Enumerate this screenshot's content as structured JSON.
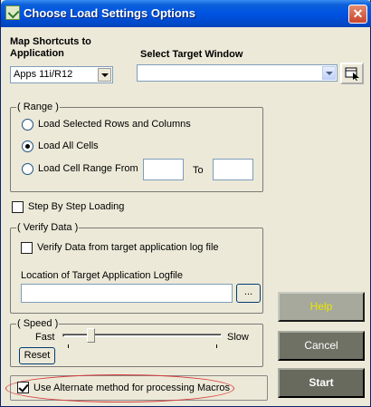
{
  "window": {
    "title": "Choose Load Settings Options",
    "close_glyph": "✕"
  },
  "mapping": {
    "label": "Map Shortcuts to Application",
    "application_value": "Apps 11i/R12"
  },
  "target": {
    "label": "Select Target Window",
    "value": ""
  },
  "range": {
    "legend": "( Range )",
    "opt_selected": "Load Selected Rows and Columns",
    "opt_all": "Load All Cells",
    "opt_cell_range": "Load Cell Range From",
    "to_label": "To",
    "from_value": "",
    "to_value": "",
    "selected_option": "Load All Cells"
  },
  "step": {
    "label": "Step By Step Loading",
    "checked": false
  },
  "verify": {
    "legend": "( Verify Data )",
    "check_label": "Verify Data from target application log file",
    "checked": false,
    "logfile_label": "Location of Target Application Logfile",
    "logfile_value": "",
    "browse_label": "..."
  },
  "speed": {
    "legend": "( Speed )",
    "fast_label": "Fast",
    "slow_label": "Slow",
    "reset_label": "Reset",
    "level": 0.15
  },
  "alternate": {
    "label": "Use Alternate method for processing Macros",
    "checked": true
  },
  "buttons": {
    "help": "Help",
    "cancel": "Cancel",
    "start": "Start"
  },
  "colors": {
    "help_text": "#e8e800",
    "title_gradient": "#0054e3",
    "highlight": "#d83c3c"
  }
}
